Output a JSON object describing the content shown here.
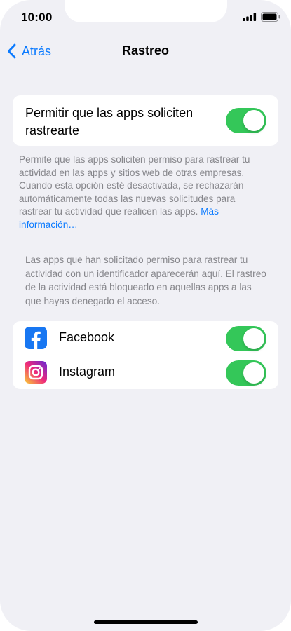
{
  "status_bar": {
    "time": "10:00"
  },
  "nav": {
    "back_label": "Atrás",
    "title": "Rastreo"
  },
  "main_setting": {
    "label": "Permitir que las apps soliciten rastrearte",
    "enabled": true
  },
  "footnote": {
    "text": "Permite que las apps soliciten permiso para rastrear tu actividad en las apps y sitios web de otras empresas. Cuando esta opción esté desactivada, se rechazarán automáticamente todas las nuevas solicitudes para rastrear tu actividad que realicen las apps.",
    "link": "Más información…"
  },
  "apps_header": "Las apps que han solicitado permiso para rastrear tu actividad con un identificador aparecerán aquí. El rastreo de la actividad está bloqueado en aquellas apps a las que hayas denegado el acceso.",
  "apps": [
    {
      "name": "Facebook",
      "icon": "facebook-icon",
      "enabled": true
    },
    {
      "name": "Instagram",
      "icon": "instagram-icon",
      "enabled": true
    }
  ],
  "colors": {
    "accent": "#0a7aff",
    "toggle_on": "#34c759",
    "background": "#f0f0f5",
    "secondary_text": "#86868b"
  }
}
